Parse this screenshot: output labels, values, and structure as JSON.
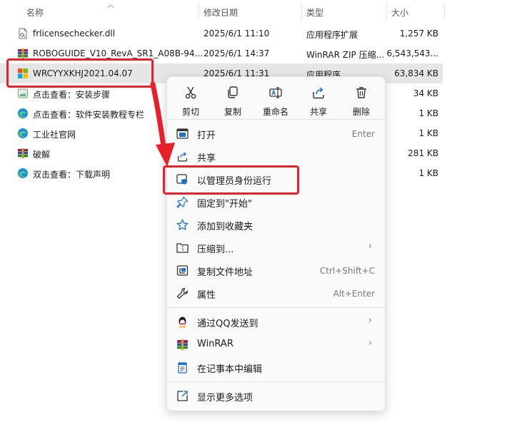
{
  "columns": {
    "name": "名称",
    "date": "修改日期",
    "type": "类型",
    "size": "大小"
  },
  "files": [
    {
      "name": "frlicensechecker.dll",
      "date": "2025/6/1 11:10",
      "type": "应用程序扩展",
      "size": "1,257 KB",
      "icon": "dll-file-icon"
    },
    {
      "name": "ROBOGUIDE_V10_RevA_SR1_A08B-94...",
      "date": "2025/6/1 14:37",
      "type": "WinRAR ZIP 压缩...",
      "size": "6,543,543...",
      "icon": "winrar-icon"
    },
    {
      "name": "WRCYYXKHJ2021.04.07",
      "date": "2025/6/1 11:31",
      "type": "应用程序",
      "size": "63,834 KB",
      "icon": "app-exe-icon"
    },
    {
      "name": "点击查看：安装步骤",
      "date": "",
      "type": "",
      "size": "34 KB",
      "icon": "image-file-icon"
    },
    {
      "name": "点击查看：软件安装教程专栏",
      "date": "",
      "type": "",
      "size": "1 KB",
      "icon": "edge-link-icon"
    },
    {
      "name": "工业社官网",
      "date": "",
      "type": "",
      "size": "1 KB",
      "icon": "edge-link-icon"
    },
    {
      "name": "破解",
      "date": "",
      "type": "",
      "size": "281 KB",
      "icon": "winrar-icon"
    },
    {
      "name": "双击查看：下载声明",
      "date": "",
      "type": "",
      "size": "1 KB",
      "icon": "edge-link-icon"
    }
  ],
  "menu": {
    "toolbar": [
      {
        "label": "剪切",
        "icon": "scissors-icon"
      },
      {
        "label": "复制",
        "icon": "copy-icon"
      },
      {
        "label": "重命名",
        "icon": "rename-icon"
      },
      {
        "label": "共享",
        "icon": "share-icon"
      },
      {
        "label": "删除",
        "icon": "trash-icon"
      }
    ],
    "items": [
      {
        "label": "打开",
        "shortcut": "Enter",
        "icon": "open-window-icon"
      },
      {
        "label": "共享",
        "shortcut": "",
        "icon": "share-icon"
      },
      {
        "label": "以管理员身份运行",
        "shortcut": "",
        "icon": "admin-shield-icon"
      },
      {
        "label": "固定到\"开始\"",
        "shortcut": "",
        "icon": "pin-icon"
      },
      {
        "label": "添加到收藏夹",
        "shortcut": "",
        "icon": "star-icon"
      },
      {
        "label": "压缩到...",
        "shortcut": "",
        "icon": "zip-folder-icon",
        "submenu": true
      },
      {
        "label": "复制文件地址",
        "shortcut": "Ctrl+Shift+C",
        "icon": "copy-path-icon"
      },
      {
        "label": "属性",
        "shortcut": "Alt+Enter",
        "icon": "wrench-icon"
      },
      {
        "label": "通过QQ发送到",
        "shortcut": "",
        "icon": "qq-penguin-icon",
        "submenu": true
      },
      {
        "label": "WinRAR",
        "shortcut": "",
        "icon": "winrar-icon",
        "submenu": true
      },
      {
        "label": "在记事本中编辑",
        "shortcut": "",
        "icon": "notepad-icon"
      },
      {
        "label": "显示更多选项",
        "shortcut": "",
        "icon": "more-options-icon"
      }
    ]
  },
  "colors": {
    "highlight": "#e8202a",
    "accent": "#1f6fd1",
    "selection": "#e6e6e6"
  }
}
